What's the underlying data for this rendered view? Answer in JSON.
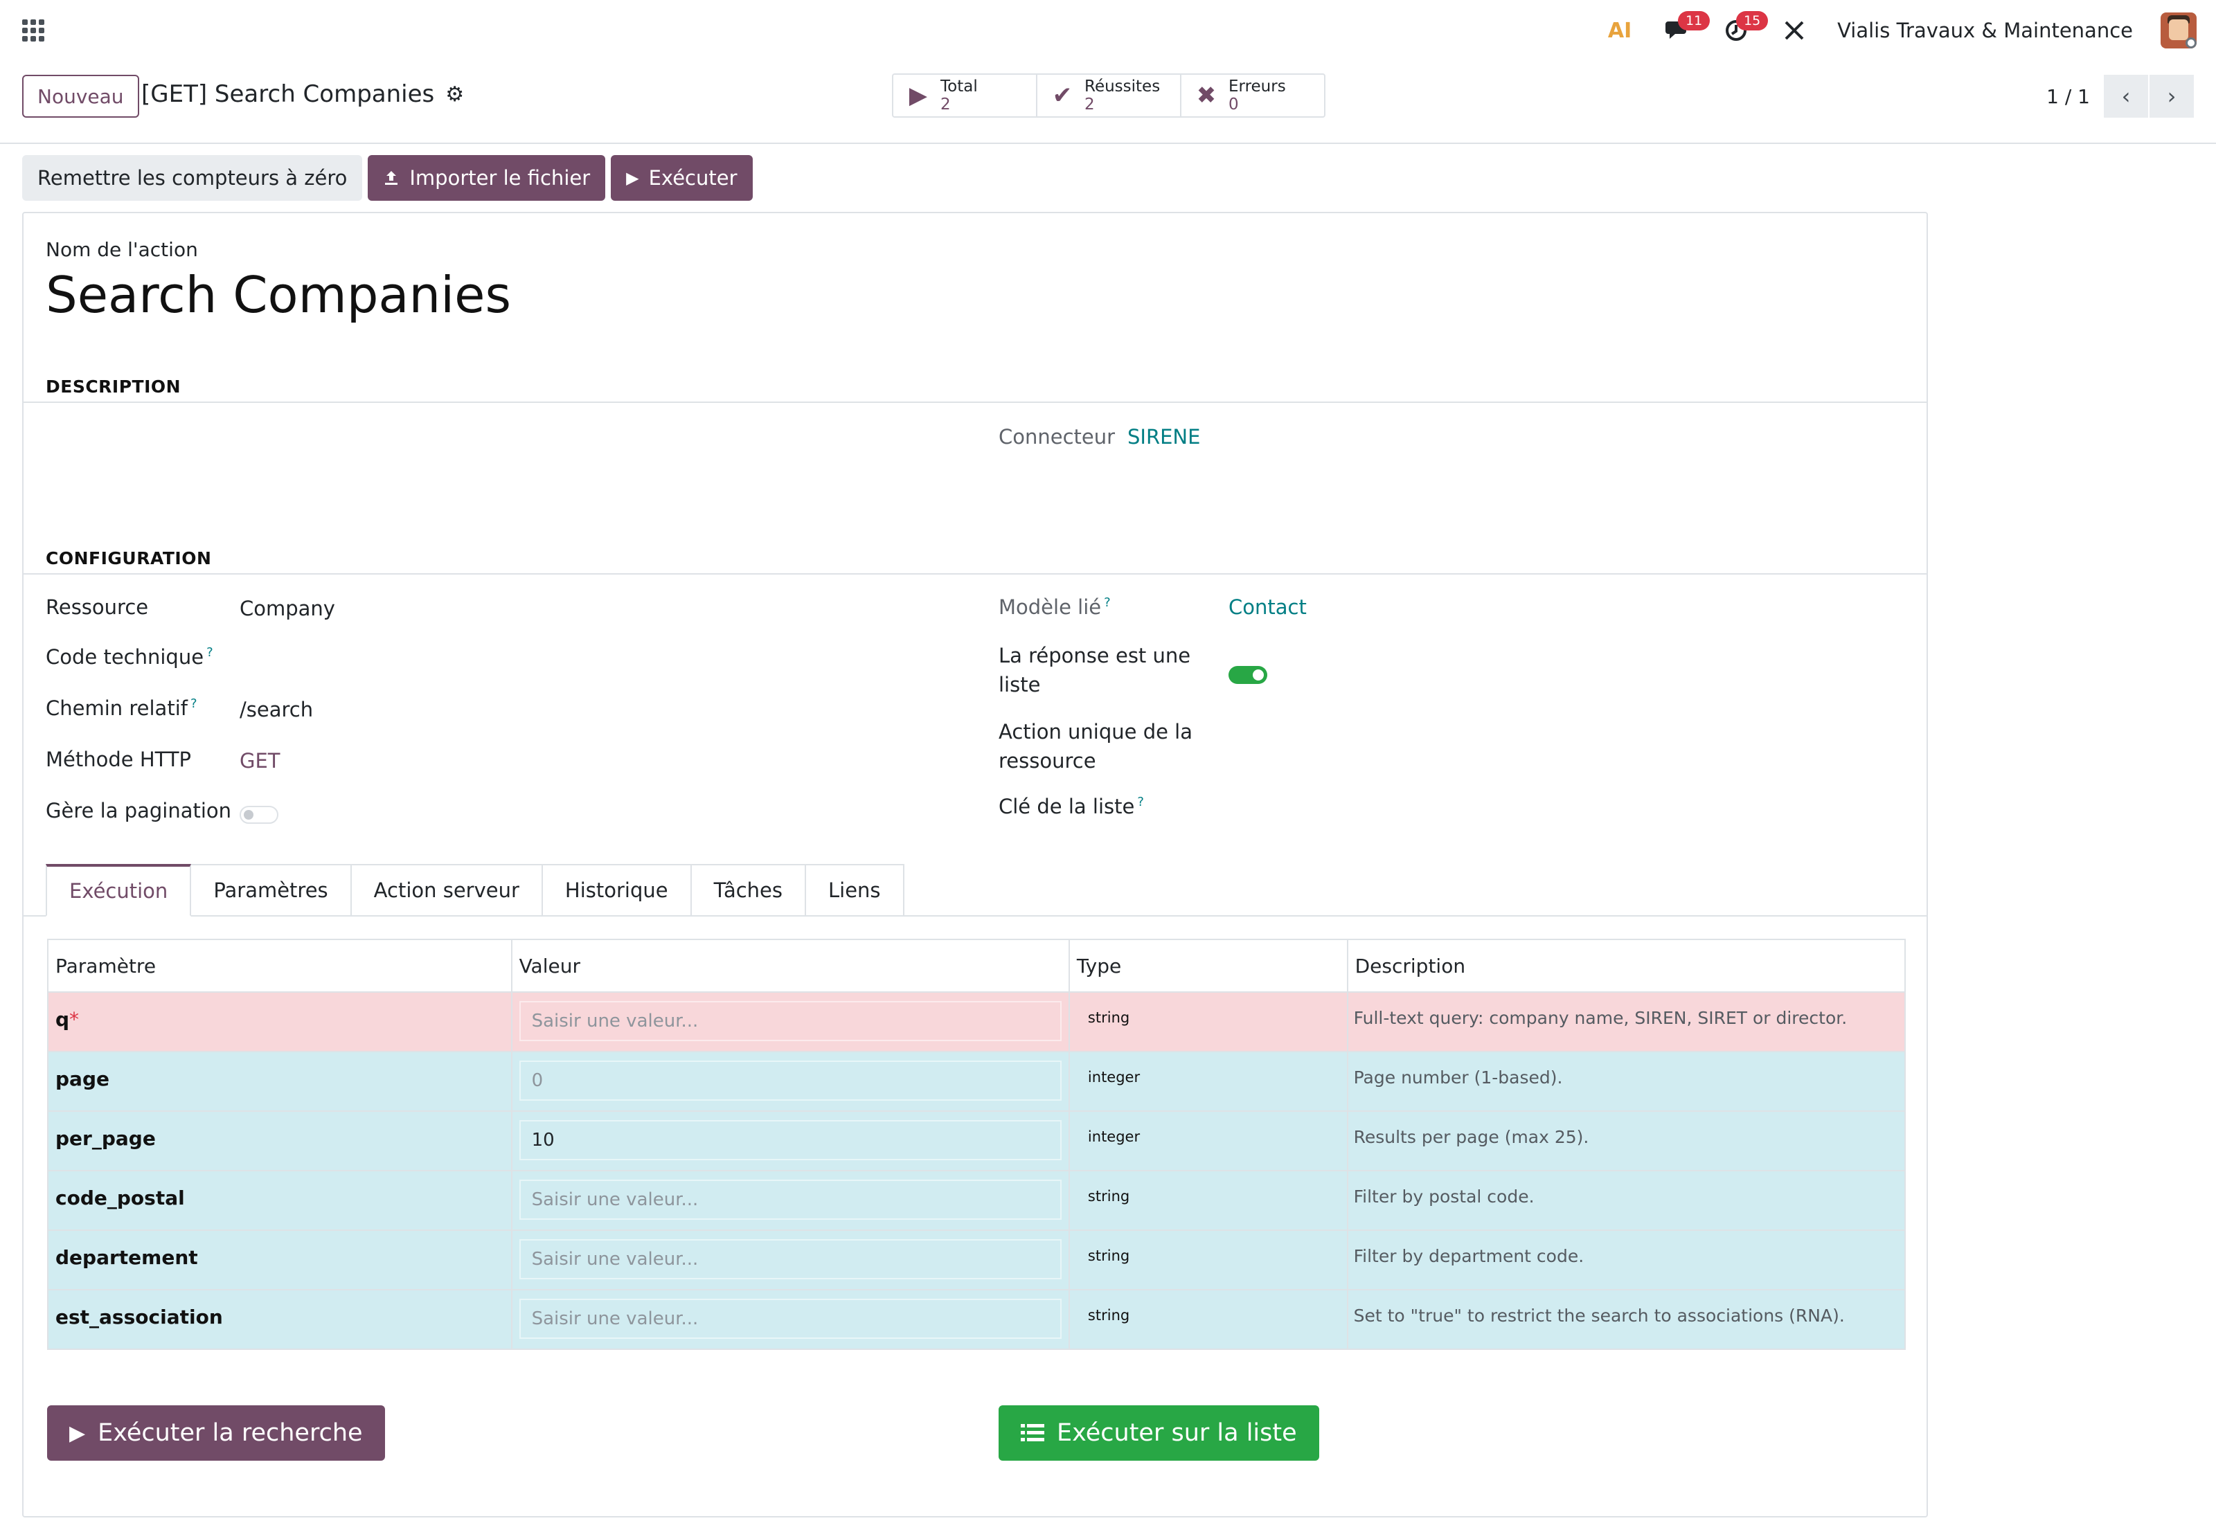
{
  "navbar": {
    "company": "Vialis Travaux & Maintenance",
    "messages_count": "11",
    "activities_count": "15",
    "ai_label": "AI"
  },
  "control_panel": {
    "new_button": "Nouveau",
    "breadcrumb": "[GET] Search Companies",
    "stats": [
      {
        "label": "Total",
        "value": "2"
      },
      {
        "label": "Réussites",
        "value": "2"
      },
      {
        "label": "Erreurs",
        "value": "0"
      }
    ],
    "pager": "1 / 1"
  },
  "actions": {
    "reset": "Remettre les compteurs à zéro",
    "import": "Importer le fichier",
    "execute": "Exécuter"
  },
  "form": {
    "name_label": "Nom de l'action",
    "name": "Search Companies",
    "description_title": "DESCRIPTION",
    "connector_label": "Connecteur",
    "connector_value": "SIRENE",
    "configuration_title": "CONFIGURATION",
    "left_fields": {
      "resource_label": "Ressource",
      "resource_value": "Company",
      "technical_code_label": "Code technique",
      "relative_path_label": "Chemin relatif",
      "relative_path_value": "/search",
      "http_method_label": "Méthode HTTP",
      "http_method_value": "GET",
      "pagination_label": "Gère la pagination",
      "pagination_on": false
    },
    "right_fields": {
      "linked_model_label": "Modèle lié",
      "linked_model_value": "Contact",
      "is_list_label_1": "La réponse est une",
      "is_list_label_2": "liste",
      "is_list_on": true,
      "unique_action_label_1": "Action unique de la",
      "unique_action_label_2": "ressource",
      "list_key_label": "Clé de la liste"
    },
    "help_mark": "?"
  },
  "tabs": [
    "Exécution",
    "Paramètres",
    "Action serveur",
    "Historique",
    "Tâches",
    "Liens"
  ],
  "params_table": {
    "headers": [
      "Paramètre",
      "Valeur",
      "Type",
      "Description"
    ],
    "placeholder": "Saisir une valeur...",
    "rows": [
      {
        "name": "q",
        "required": true,
        "value": "",
        "type": "string",
        "description": "Full-text query: company name, SIREN, SIRET or director."
      },
      {
        "name": "page",
        "required": false,
        "value": "0",
        "type": "integer",
        "description": "Page number (1-based)."
      },
      {
        "name": "per_page",
        "required": false,
        "value": "10",
        "type": "integer",
        "description": "Results per page (max 25)."
      },
      {
        "name": "code_postal",
        "required": false,
        "value": "",
        "type": "string",
        "description": "Filter by postal code."
      },
      {
        "name": "departement",
        "required": false,
        "value": "",
        "type": "string",
        "description": "Filter by department code."
      },
      {
        "name": "est_association",
        "required": false,
        "value": "",
        "type": "string",
        "description": "Set to \"true\" to restrict the search to associations (RNA)."
      }
    ]
  },
  "bottom_buttons": {
    "run_search": "Exécuter la recherche",
    "run_list": "Exécuter sur la liste"
  },
  "colors": {
    "primary": "#714b67",
    "link": "#017e84",
    "success": "#28a745",
    "required_row": "#f8d7da",
    "optional_row": "#d1ecf1"
  }
}
